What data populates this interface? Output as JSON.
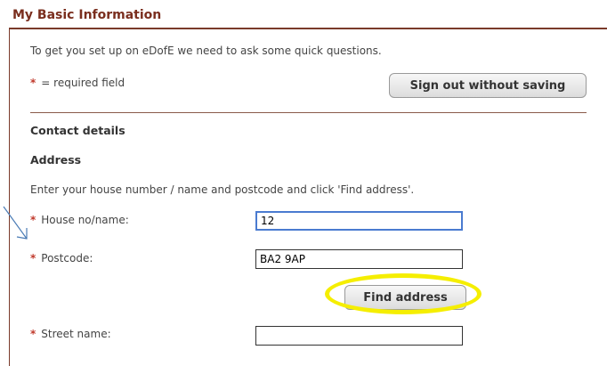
{
  "section": {
    "title": "My Basic Information"
  },
  "intro": "To get you set up on eDofE we need to ask some quick questions.",
  "required_note": {
    "marker": "*",
    "text": "= required field"
  },
  "buttons": {
    "sign_out": "Sign out without saving",
    "find_address": "Find address"
  },
  "contact": {
    "heading": "Contact details",
    "address_heading": "Address",
    "instructions": "Enter your house number / name and postcode and click 'Find address'."
  },
  "fields": {
    "house": {
      "label": "House no/name:",
      "value": "12"
    },
    "postcode": {
      "label": "Postcode:",
      "value": "BA2 9AP"
    },
    "street": {
      "label": "Street name:",
      "value": ""
    }
  },
  "colors": {
    "title": "#7a2e1e",
    "required": "#c0392b",
    "highlight": "#f5ee00",
    "annotation_arrow": "#4a7bb5",
    "focus_border": "#4a7bd0"
  }
}
